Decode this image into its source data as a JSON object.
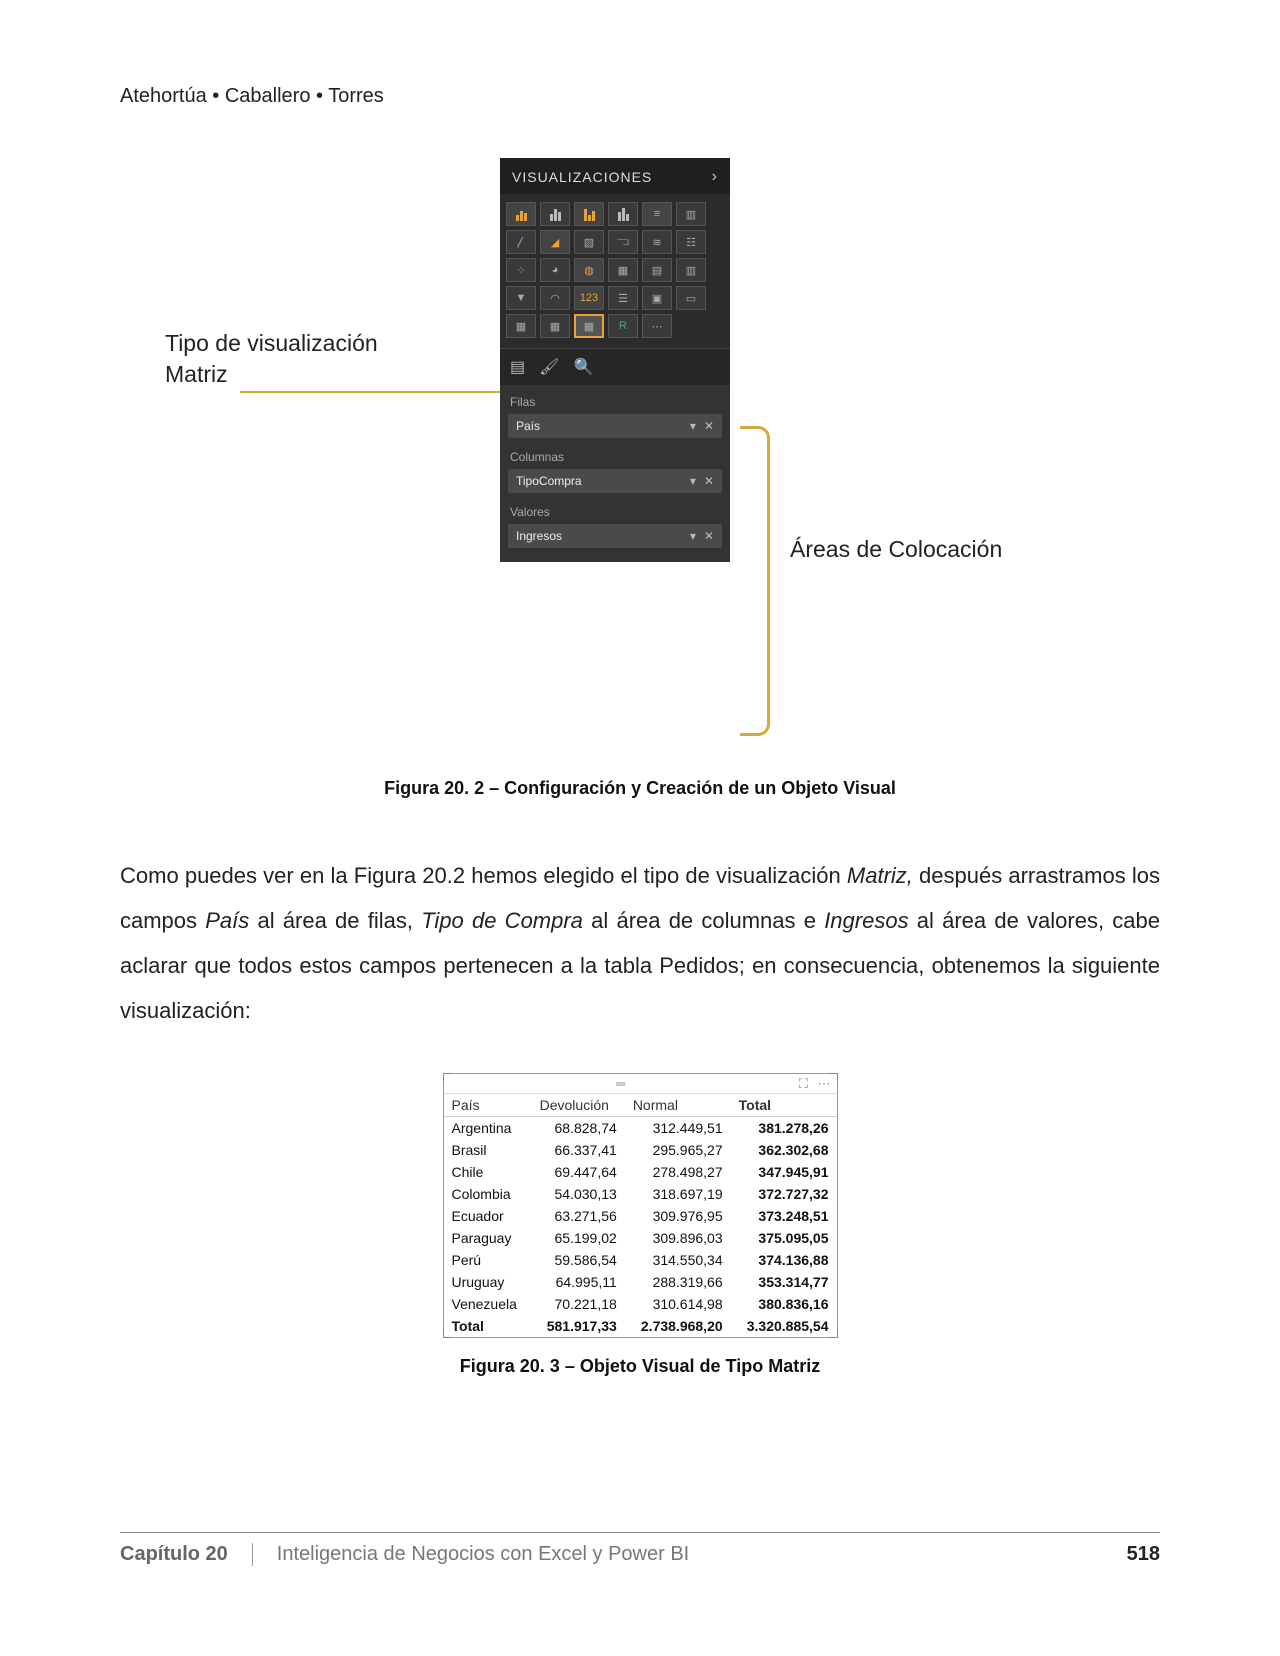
{
  "header": {
    "authors": "Atehortúa • Caballero • Torres"
  },
  "fig202": {
    "annot_left_l1": "Tipo de visualización",
    "annot_left_l2": "Matriz",
    "annot_right": "Áreas de Colocación",
    "panel_title": "VISUALIZACIONES",
    "wells": {
      "filas_label": "Filas",
      "filas_value": "País",
      "columnas_label": "Columnas",
      "columnas_value": "TipoCompra",
      "valores_label": "Valores",
      "valores_value": "Ingresos"
    },
    "caption": "Figura 20. 2 – Configuración y Creación de un Objeto Visual"
  },
  "paragraph": {
    "t1": "Como puedes ver en la Figura 20.2 hemos elegido el tipo de visualización ",
    "i1": "Matriz,",
    "t2": " después arrastramos los campos ",
    "i2": "País",
    "t3": " al área de filas, ",
    "i3": "Tipo de Compra",
    "t4": " al área de columnas e ",
    "i4": "Ingresos",
    "t5": " al área de valores, cabe aclarar que todos estos campos pertenecen a la tabla Pedidos; en consecuencia, obtenemos la siguiente visualización:"
  },
  "matrix": {
    "headers": {
      "c0": "País",
      "c1": "Devolución",
      "c2": "Normal",
      "c3": "Total"
    },
    "rows": [
      {
        "pais": "Argentina",
        "dev": "68.828,74",
        "nor": "312.449,51",
        "tot": "381.278,26"
      },
      {
        "pais": "Brasil",
        "dev": "66.337,41",
        "nor": "295.965,27",
        "tot": "362.302,68"
      },
      {
        "pais": "Chile",
        "dev": "69.447,64",
        "nor": "278.498,27",
        "tot": "347.945,91"
      },
      {
        "pais": "Colombia",
        "dev": "54.030,13",
        "nor": "318.697,19",
        "tot": "372.727,32"
      },
      {
        "pais": "Ecuador",
        "dev": "63.271,56",
        "nor": "309.976,95",
        "tot": "373.248,51"
      },
      {
        "pais": "Paraguay",
        "dev": "65.199,02",
        "nor": "309.896,03",
        "tot": "375.095,05"
      },
      {
        "pais": "Perú",
        "dev": "59.586,54",
        "nor": "314.550,34",
        "tot": "374.136,88"
      },
      {
        "pais": "Uruguay",
        "dev": "64.995,11",
        "nor": "288.319,66",
        "tot": "353.314,77"
      },
      {
        "pais": "Venezuela",
        "dev": "70.221,18",
        "nor": "310.614,98",
        "tot": "380.836,16"
      }
    ],
    "total": {
      "label": "Total",
      "dev": "581.917,33",
      "nor": "2.738.968,20",
      "tot": "3.320.885,54"
    },
    "caption": "Figura 20. 3 – Objeto Visual de Tipo Matriz"
  },
  "footer": {
    "chapter": "Capítulo 20",
    "title": "Inteligencia de Negocios con Excel y Power BI",
    "page": "518"
  },
  "chart_data": {
    "type": "table",
    "title": "Objeto Visual de Tipo Matriz",
    "columns": [
      "País",
      "Devolución",
      "Normal",
      "Total"
    ],
    "rows": [
      [
        "Argentina",
        68828.74,
        312449.51,
        381278.26
      ],
      [
        "Brasil",
        66337.41,
        295965.27,
        362302.68
      ],
      [
        "Chile",
        69447.64,
        278498.27,
        347945.91
      ],
      [
        "Colombia",
        54030.13,
        318697.19,
        372727.32
      ],
      [
        "Ecuador",
        63271.56,
        309976.95,
        373248.51
      ],
      [
        "Paraguay",
        65199.02,
        309896.03,
        375095.05
      ],
      [
        "Perú",
        59586.54,
        314550.34,
        374136.88
      ],
      [
        "Uruguay",
        64995.11,
        288319.66,
        353314.77
      ],
      [
        "Venezuela",
        70221.18,
        310614.98,
        380836.16
      ],
      [
        "Total",
        581917.33,
        2738968.2,
        3320885.54
      ]
    ]
  }
}
